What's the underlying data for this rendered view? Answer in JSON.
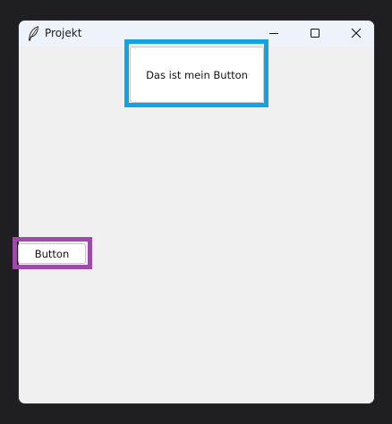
{
  "window": {
    "title": "Projekt",
    "app_icon": "feather-icon",
    "controls": {
      "minimize_icon": "minimize-icon",
      "maximize_icon": "maximize-icon",
      "close_icon": "close-icon"
    }
  },
  "buttons": {
    "primary_label": "Das ist mein Button",
    "secondary_label": "Button"
  },
  "highlights": {
    "primary_color": "#12a3e3",
    "secondary_color": "#9d4ba8"
  }
}
